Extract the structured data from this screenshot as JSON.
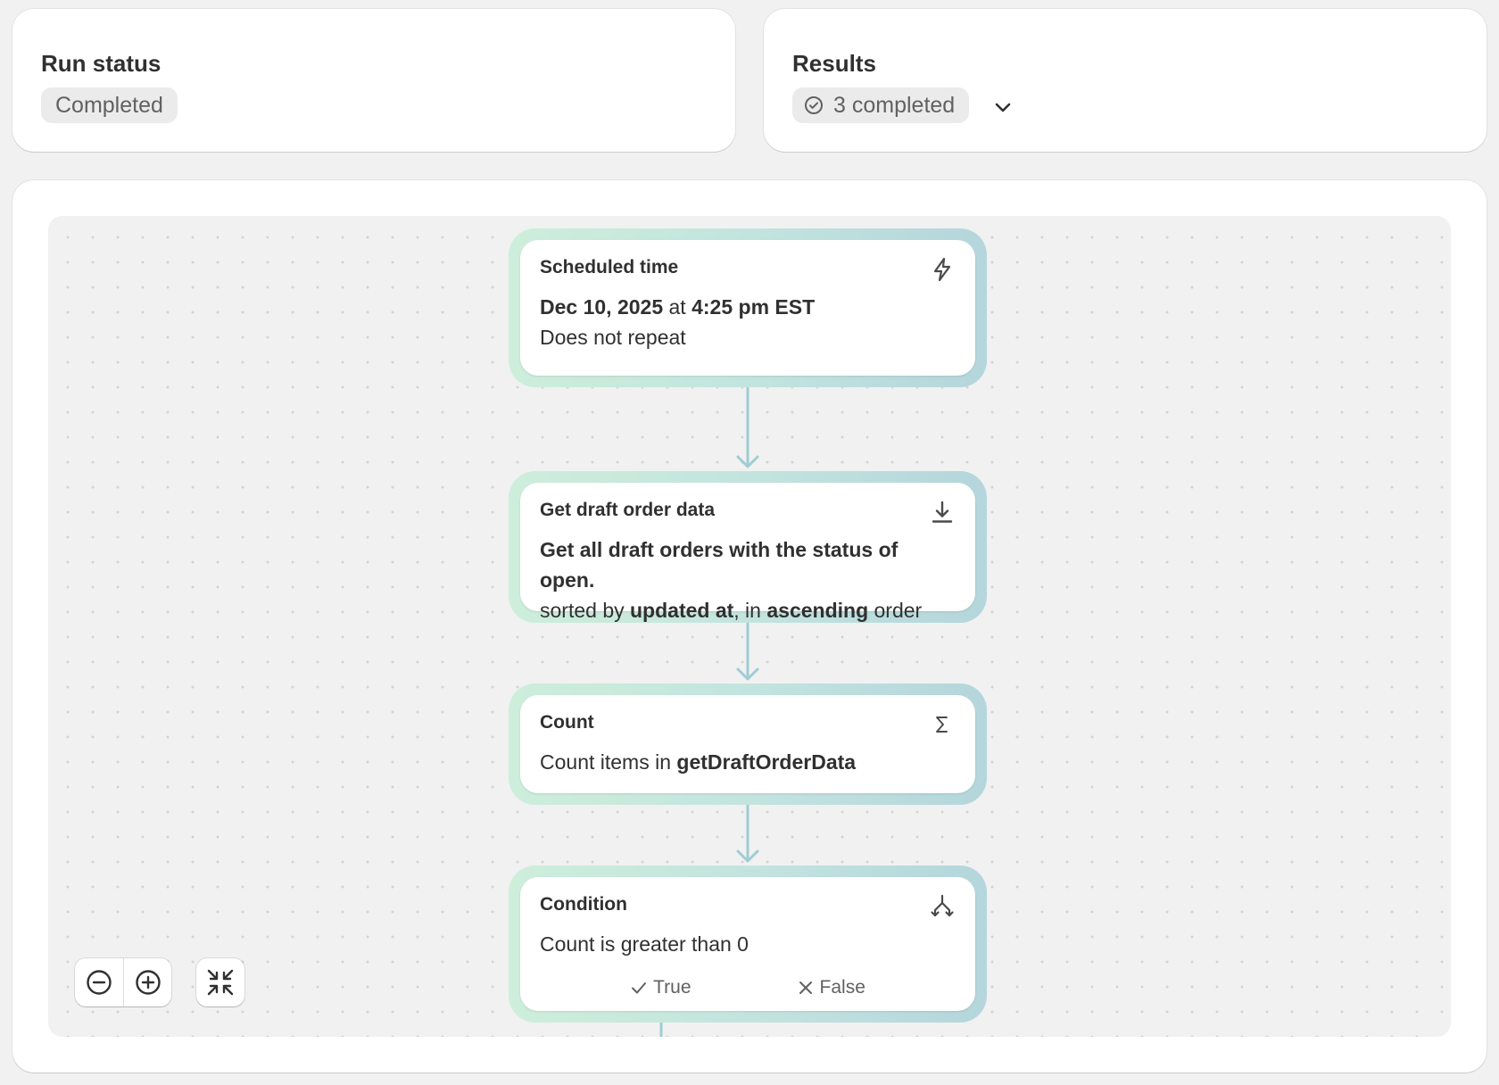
{
  "run_status": {
    "title": "Run status",
    "badge": "Completed"
  },
  "results": {
    "title": "Results",
    "badge": "3 completed",
    "badge_icon": "check-circle-icon",
    "toggle_icon": "chevron-down-icon"
  },
  "workflow": {
    "trigger": {
      "title": "Scheduled time",
      "icon": "lightning-icon",
      "date": "Dec 10, 2025",
      "at": " at ",
      "time": "4:25 pm EST",
      "repeat": "Does not repeat"
    },
    "get_data": {
      "title": "Get draft order data",
      "icon": "download-icon",
      "line1": "Get all draft orders with the status of open.",
      "sorted_prefix": "sorted by ",
      "sort_field": "updated at",
      "sort_mid": ", in ",
      "sort_dir": "ascending",
      "sort_suffix": " order"
    },
    "count": {
      "title": "Count",
      "icon": "sigma-icon",
      "prefix": "Count items in ",
      "target": "getDraftOrderData"
    },
    "condition": {
      "title": "Condition",
      "icon": "branch-icon",
      "text": "Count is greater than 0",
      "true_label": "True",
      "false_label": "False"
    }
  },
  "controls": {
    "zoom_out_icon": "zoom-out-icon",
    "zoom_in_icon": "zoom-in-icon",
    "fit_icon": "fit-view-icon"
  },
  "colors": {
    "connector": "#9fcdd3",
    "node_gradient_start": "#cdeedb",
    "node_gradient_end": "#b4d6dc",
    "badge_bg": "#ebebeb"
  }
}
